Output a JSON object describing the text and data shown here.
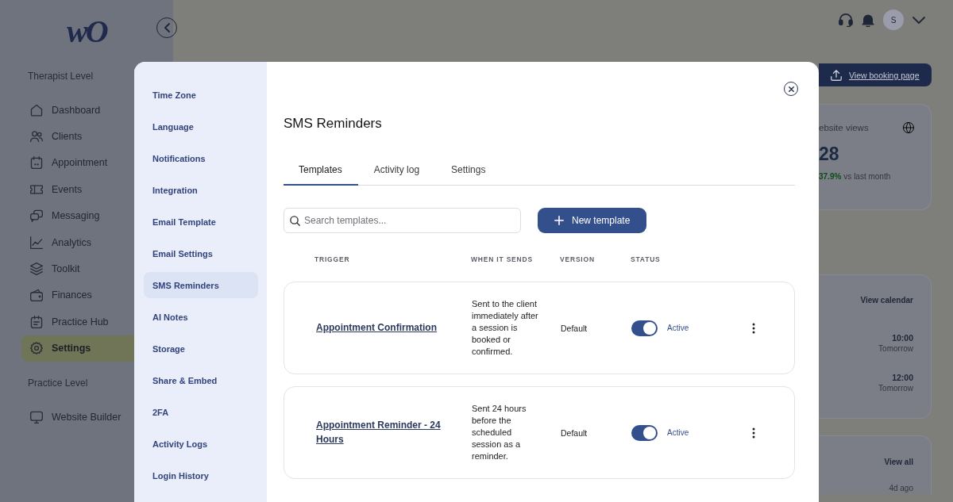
{
  "app": {
    "logo": "wO",
    "sidebar": {
      "sections": [
        {
          "heading": "Therapist Level",
          "items": [
            {
              "label": "Dashboard",
              "selected": false
            },
            {
              "label": "Clients",
              "selected": false
            },
            {
              "label": "Appointment",
              "selected": false
            },
            {
              "label": "Events",
              "selected": false
            },
            {
              "label": "Messaging",
              "selected": false
            },
            {
              "label": "Analytics",
              "selected": false
            },
            {
              "label": "Toolkit",
              "selected": false
            },
            {
              "label": "Finances",
              "selected": false
            },
            {
              "label": "Practice Hub",
              "selected": false
            },
            {
              "label": "Settings",
              "selected": true
            }
          ]
        },
        {
          "heading": "Practice Level",
          "items": [
            {
              "label": "Website Builder",
              "selected": false
            }
          ]
        }
      ]
    },
    "header": {
      "avatar_initial": "S"
    },
    "booking_button": "View booking page",
    "stat_card": {
      "label": "ebsite views",
      "value": "28",
      "change": "37.9%",
      "comparison": "vs last month"
    },
    "schedule_card": {
      "link": "View calendar",
      "entries": [
        {
          "time": "10:00",
          "day": "Tomorrow"
        },
        {
          "time": "12:00",
          "day": "Tomorrow"
        }
      ]
    },
    "activity_card": {
      "link": "View all",
      "entries": [
        {
          "time": "4d ago"
        }
      ]
    }
  },
  "modal": {
    "nav": [
      {
        "label": "Time Zone",
        "selected": false
      },
      {
        "label": "Language",
        "selected": false
      },
      {
        "label": "Notifications",
        "selected": false
      },
      {
        "label": "Integration",
        "selected": false
      },
      {
        "label": "Email Template",
        "selected": false
      },
      {
        "label": "Email Settings",
        "selected": false
      },
      {
        "label": "SMS Reminders",
        "selected": true
      },
      {
        "label": "AI Notes",
        "selected": false
      },
      {
        "label": "Storage",
        "selected": false
      },
      {
        "label": "Share & Embed",
        "selected": false
      },
      {
        "label": "2FA",
        "selected": false
      },
      {
        "label": "Activity Logs",
        "selected": false
      },
      {
        "label": "Login History",
        "selected": false
      }
    ],
    "title": "SMS Reminders",
    "tabs": [
      {
        "label": "Templates",
        "selected": true
      },
      {
        "label": "Activity log",
        "selected": false
      },
      {
        "label": "Settings",
        "selected": false
      }
    ],
    "search": {
      "placeholder": "Search templates..."
    },
    "new_button": "New template",
    "table": {
      "columns": [
        "TRIGGER",
        "WHEN IT SENDS",
        "VERSION",
        "STATUS"
      ],
      "rows": [
        {
          "trigger": "Appointment Confirmation",
          "when": "Sent to the client immediately after a session is booked or confirmed.",
          "version": "Default",
          "active": true,
          "status": "Active"
        },
        {
          "trigger": "Appointment Reminder - 24 Hours",
          "when": "Sent 24 hours before the scheduled session as a reminder.",
          "version": "Default",
          "active": true,
          "status": "Active"
        }
      ]
    }
  }
}
